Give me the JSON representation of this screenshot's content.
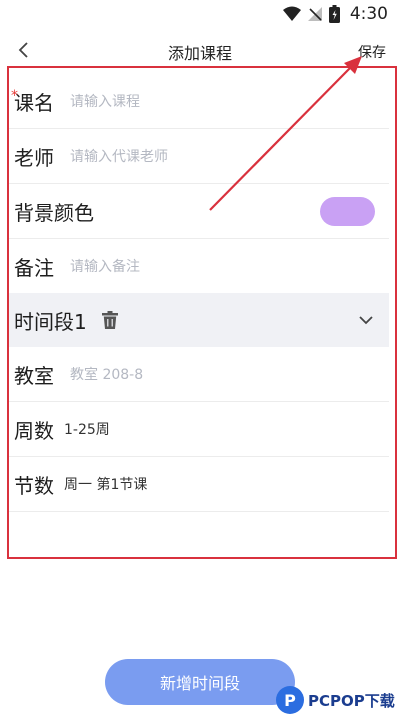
{
  "status_bar": {
    "time": "4:30"
  },
  "header": {
    "title": "添加课程",
    "save_label": "保存"
  },
  "form": {
    "course_name": {
      "label": "课名",
      "required_mark": "*",
      "placeholder": "请输入课程"
    },
    "teacher": {
      "label": "老师",
      "placeholder": "请输入代课老师"
    },
    "bg_color": {
      "label": "背景颜色",
      "color": "#c9a1f4"
    },
    "note": {
      "label": "备注",
      "placeholder": "请输入备注"
    },
    "time_slot": {
      "label": "时间段1"
    },
    "classroom": {
      "label": "教室",
      "placeholder": "教室 208-8"
    },
    "weeks": {
      "label": "周数",
      "value": "1-25周"
    },
    "sessions": {
      "label": "节数",
      "value": "周一 第1节课"
    }
  },
  "add_button": {
    "label": "新增时间段",
    "color": "#7a9cf0"
  },
  "watermark": {
    "logo_letter": "P",
    "text": "PCPOP下载"
  },
  "colors": {
    "annotation": "#d9313d"
  }
}
